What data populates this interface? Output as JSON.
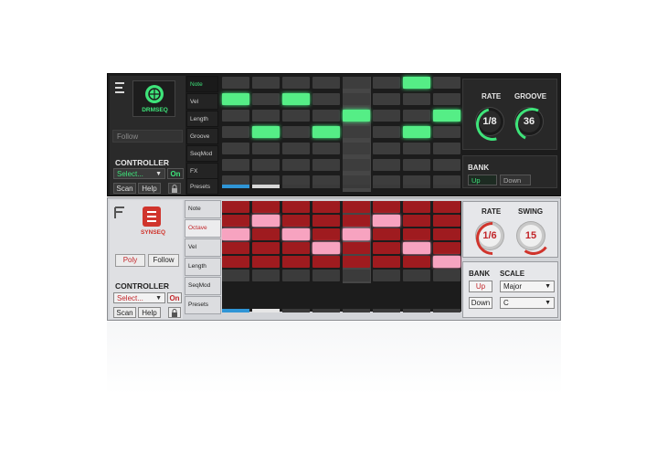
{
  "drmseq": {
    "logo_text": "DRMSEQ",
    "follow_label": "Follow",
    "controller_label": "CONTROLLER",
    "select_value": "Select...",
    "on_label": "On",
    "scan_label": "Scan",
    "help_label": "Help",
    "tabs": [
      "Note",
      "Vel",
      "Length",
      "Groove",
      "SeqMod",
      "FX",
      "Presets"
    ],
    "active_tab_index": 0,
    "rate_label": "RATE",
    "rate_value": "1/8",
    "groove_label": "GROOVE",
    "groove_value": "36",
    "bank_label": "BANK",
    "bank_up": "Up",
    "bank_down": "Down",
    "accent_color": "#3ee47a",
    "grid_active": [
      [
        0,
        6
      ],
      [
        1,
        0
      ],
      [
        1,
        2
      ],
      [
        2,
        4
      ],
      [
        2,
        7
      ],
      [
        3,
        1
      ],
      [
        3,
        3
      ],
      [
        3,
        6
      ]
    ],
    "highlighted_column": 4
  },
  "synseq": {
    "logo_text": "SYNSEQ",
    "poly_label": "Poly",
    "follow_label": "Follow",
    "controller_label": "CONTROLLER",
    "select_value": "Select...",
    "on_label": "On",
    "scan_label": "Scan",
    "help_label": "Help",
    "tabs": [
      "Note",
      "Octave",
      "Vel",
      "Length",
      "SeqMod",
      "Presets"
    ],
    "active_tab_index": 1,
    "rate_label": "RATE",
    "rate_value": "1/6",
    "swing_label": "SWING",
    "swing_value": "15",
    "bank_label": "BANK",
    "bank_up": "Up",
    "bank_down": "Down",
    "scale_label": "SCALE",
    "scale_value": "Major",
    "key_value": "C",
    "accent_color": "#c2262a",
    "grid_pink": [
      [
        1,
        1
      ],
      [
        1,
        5
      ],
      [
        2,
        0
      ],
      [
        2,
        2
      ],
      [
        2,
        4
      ],
      [
        3,
        3
      ],
      [
        3,
        6
      ],
      [
        4,
        7
      ]
    ],
    "highlighted_column": 4
  }
}
